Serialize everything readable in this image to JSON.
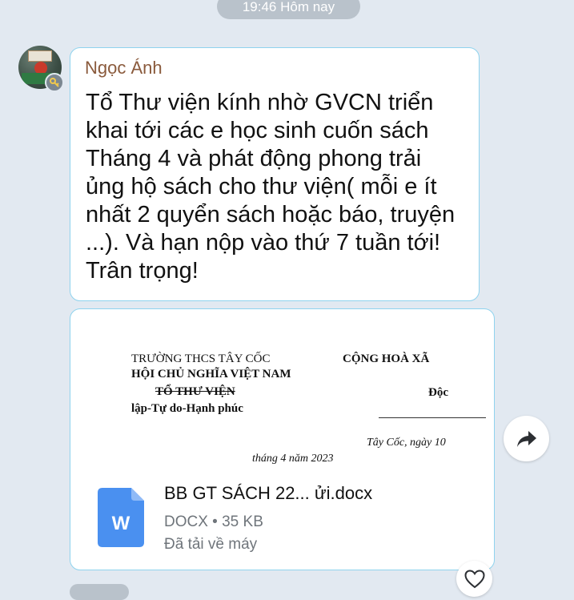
{
  "timestamp": "19:46 Hôm nay",
  "message": {
    "sender": "Ngọc Ánh",
    "text": "Tổ Thư viện kính nhờ GVCN triển\nkhai tới các e học sinh cuốn sách\nTháng 4 và phát động phong trải\nủng hộ sách cho thư viện( mỗi e ít\nnhất 2 quyển sách hoặc báo, truyện\n...). Và hạn nộp vào thứ 7 tuần tới!\nTrân trọng!"
  },
  "attachment": {
    "preview_lines": {
      "school": "TRƯỜNG THCS TÂY CỐC",
      "republic": "CỘNG HOÀ XÃ",
      "socialist": "HỘI CHỦ NGHĨA VIỆT NAM",
      "group": "TỔ THƯ VIỆN",
      "independence": "Độc",
      "freedom": "lập-Tự do-Hạnh phúc",
      "date_line1": "Tây Cốc, ngày 10",
      "date_line2": "tháng 4 năm 2023"
    },
    "icon_letter": "W",
    "icon_color": "#4a90f0",
    "file_name": "BB GT SÁCH 22... ửi.docx",
    "file_meta": "DOCX • 35 KB",
    "status": "Đã tải về máy"
  },
  "icons": {
    "share": "share-forward-icon",
    "reaction": "heart-icon",
    "badge": "key-icon"
  },
  "colors": {
    "background": "#e2e9f1",
    "bubble_border": "#8fd3ee",
    "sender_name": "#8a5a3c",
    "meta_text": "#6f757b"
  }
}
